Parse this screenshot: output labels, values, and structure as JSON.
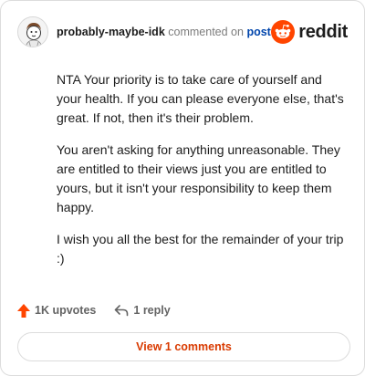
{
  "comment": {
    "username": "probably-maybe-idk",
    "commented_text": "commented on",
    "post_link": "post",
    "paragraphs": [
      "NTA Your priority is to take care of yourself and your health. If you can please everyone else, that's great. If not, then it's their problem.",
      "You aren't asking for anything unreasonable. They are entitled to their views just you are entitled to yours, but it isn't your responsibility to keep them happy.",
      "I wish you all the best for the remainder of your trip :)"
    ]
  },
  "brand": {
    "wordmark": "reddit",
    "color": "#ff4500"
  },
  "actions": {
    "upvotes": "1K upvotes",
    "replies": "1 reply",
    "upvote_color": "#ff4500"
  },
  "footer": {
    "view_comments": "View 1 comments"
  },
  "icons": {
    "avatar": "avatar-icon",
    "logo": "reddit-alien-icon",
    "upvote": "upvote-arrow-icon",
    "reply": "reply-arrow-icon"
  }
}
